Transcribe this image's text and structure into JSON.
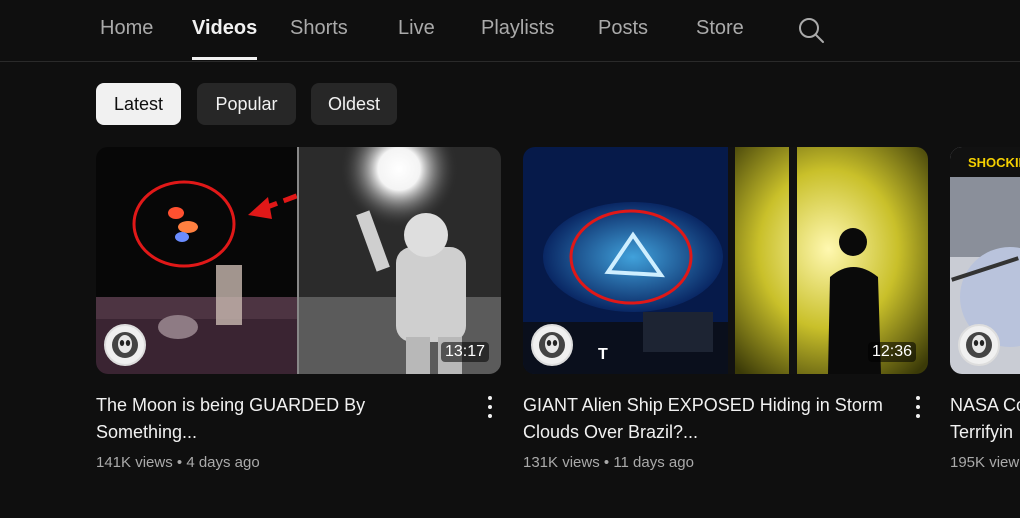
{
  "nav": {
    "tabs": [
      {
        "label": "Home"
      },
      {
        "label": "Videos",
        "active": true
      },
      {
        "label": "Shorts"
      },
      {
        "label": "Live"
      },
      {
        "label": "Playlists"
      },
      {
        "label": "Posts"
      },
      {
        "label": "Store"
      }
    ],
    "search_icon": "search-icon"
  },
  "filters": {
    "chips": [
      {
        "label": "Latest",
        "selected": true
      },
      {
        "label": "Popular"
      },
      {
        "label": "Oldest"
      }
    ]
  },
  "videos": [
    {
      "title_line1": "The Moon is being GUARDED By",
      "title_line2": "Something...",
      "views": "141K views",
      "age": "4 days ago",
      "duration": "13:17"
    },
    {
      "title_line1": "GIANT Alien Ship EXPOSED Hiding in Storm",
      "title_line2": "Clouds Over Brazil?...",
      "views": "131K views",
      "age": "11 days ago",
      "duration": "12:36",
      "thumb_text": "T"
    },
    {
      "title_line1": "NASA Co",
      "title_line2": "Terrifyin",
      "views": "195K view",
      "thumb_text": "SHOCKING"
    }
  ],
  "colors": {
    "background": "#0f0f0f",
    "chip": "#272727",
    "chip_selected": "#f1f1f1",
    "secondary_text": "#aaaaaa",
    "highlight_red": "#e02020"
  }
}
